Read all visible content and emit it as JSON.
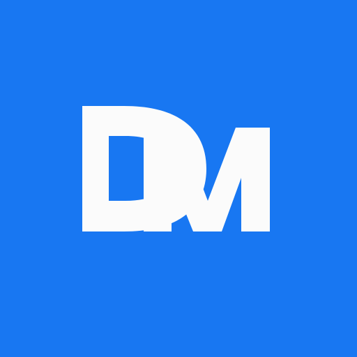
{
  "app_icon": {
    "name": "dm-logo-icon",
    "monogram": "DM",
    "background_color": "#1877f2",
    "foreground_color": "#fbfbfb"
  }
}
